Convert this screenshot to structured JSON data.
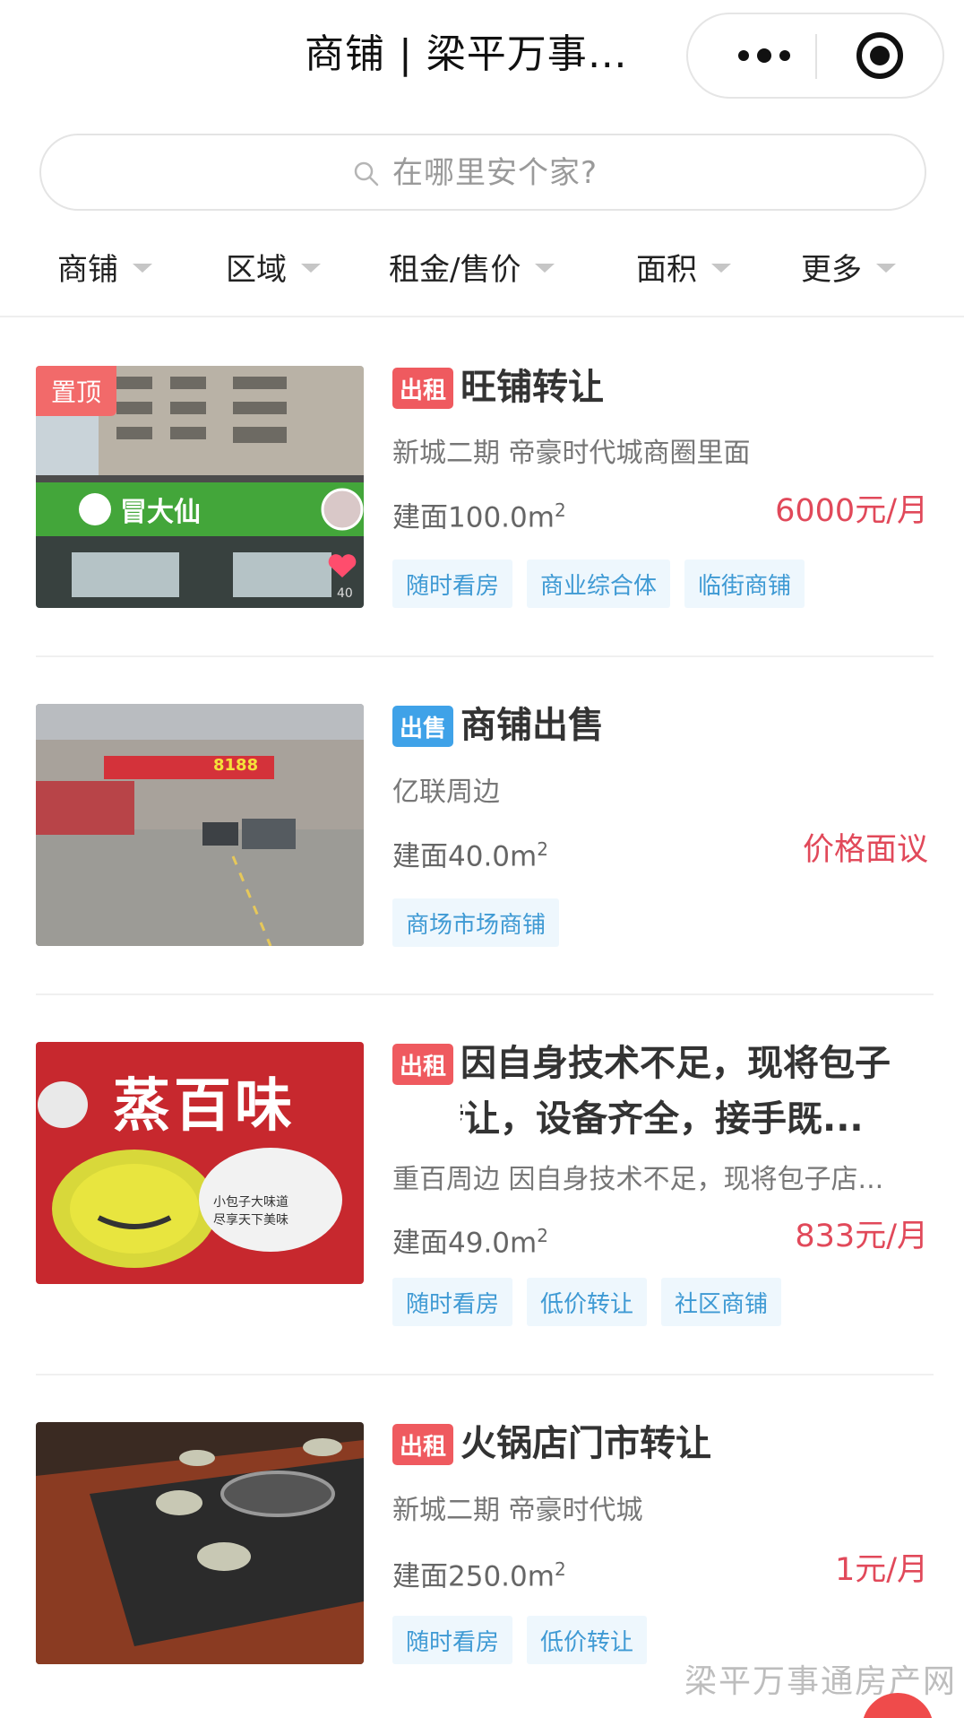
{
  "header": {
    "title": "商铺 | 梁平万事…"
  },
  "search": {
    "placeholder": "在哪里安个家?"
  },
  "filters": [
    "商铺",
    "区域",
    "租金/售价",
    "面积",
    "更多"
  ],
  "listings": [
    {
      "badge": "出租",
      "title": "旺铺转让",
      "subtitle": "新城二期 帝豪时代城商圈里面",
      "area_label": "建面100.0m",
      "area_sup": "2",
      "price": "6000元/月",
      "tags": [
        "随时看房",
        "商业综合体",
        "临街商铺"
      ],
      "pinned": "置顶",
      "photo_sign": "冒大仙",
      "photo_count": "40"
    },
    {
      "badge": "出售",
      "title": "商铺出售",
      "subtitle": "亿联周边",
      "area_label": "建面40.0m",
      "area_sup": "2",
      "price": "价格面议",
      "tags": [
        "商场市场商铺"
      ],
      "photo_sign": "8188"
    },
    {
      "badge": "出租",
      "title_line1": "因自身技术不足，现将包子",
      "title_line2": "店转让，设备齐全，接手既...",
      "subtitle": "重百周边 因自身技术不足，现将包子店...",
      "area_label": "建面49.0m",
      "area_sup": "2",
      "price": "833元/月",
      "tags": [
        "随时看房",
        "低价转让",
        "社区商铺"
      ],
      "photo_sign": "蒸百味",
      "photo_slogan1": "小包子大味道",
      "photo_slogan2": "尽享天下美味"
    },
    {
      "badge": "出租",
      "title": "火锅店门市转让",
      "subtitle": "新城二期 帝豪时代城",
      "area_label": "建面250.0m",
      "area_sup": "2",
      "price": "1元/月",
      "tags": [
        "随时看房",
        "低价转让"
      ]
    }
  ],
  "watermark": "梁平万事通房产网",
  "colors": {
    "rent_badge": "#ef5a5f",
    "sale_badge": "#3fa2e8",
    "price": "#e1495a",
    "tag_text": "#3f9ad4",
    "tag_bg": "#eef7fd"
  }
}
